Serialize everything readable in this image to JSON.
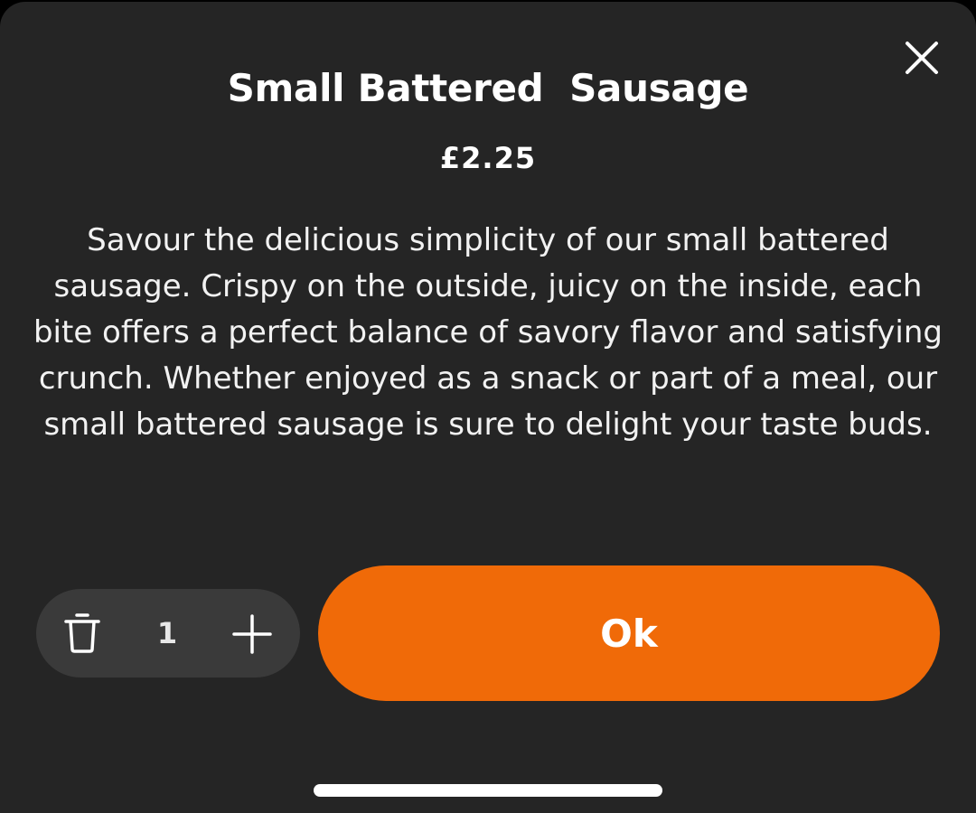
{
  "item": {
    "title": "Small Battered  Sausage",
    "price": "£2.25",
    "description": "Savour the delicious simplicity of our small battered sausage. Crispy on the outside, juicy on the inside, each bite offers a perfect balance of savory flavor and satisfying crunch. Whether enjoyed as a snack or part of a meal, our small battered sausage is sure to delight your taste buds."
  },
  "quantity": {
    "value": "1"
  },
  "actions": {
    "ok_label": "Ok"
  },
  "icons": {
    "close": "close-icon",
    "delete": "trash-icon",
    "increment": "plus-icon"
  },
  "colors": {
    "background": "#252525",
    "accent": "#f06a08",
    "stepper": "#3a3a3a",
    "text": "#ffffff"
  }
}
